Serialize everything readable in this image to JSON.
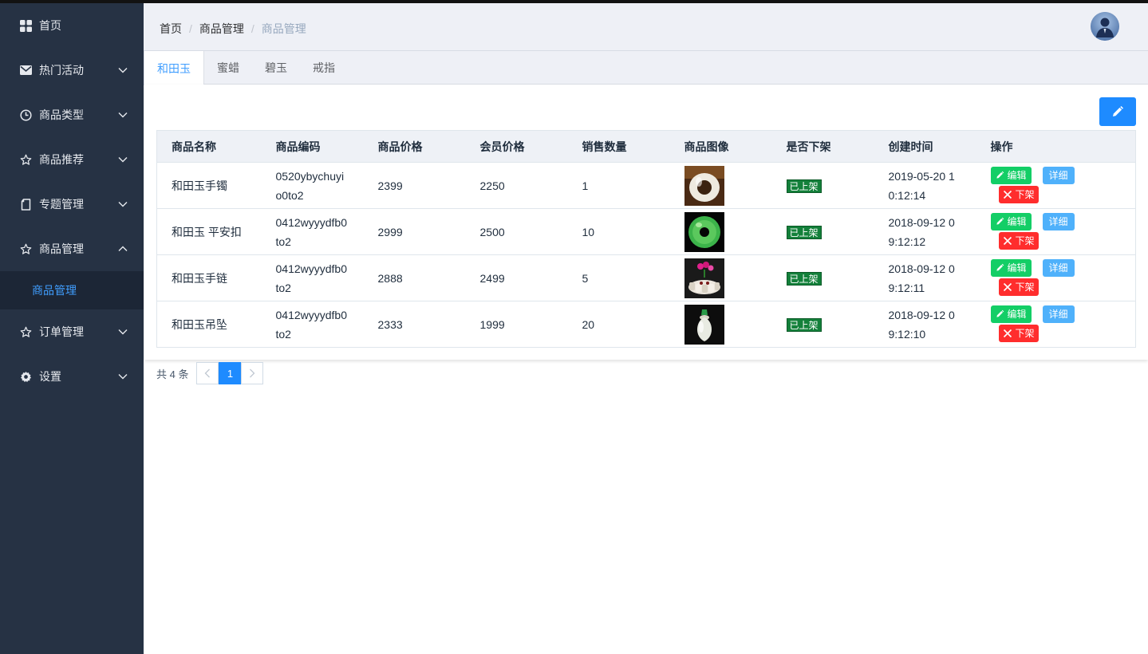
{
  "sidebar": {
    "items": [
      {
        "label": "首页",
        "icon": "dashboard-icon",
        "expanded": null
      },
      {
        "label": "热门活动",
        "icon": "envelope-icon",
        "expanded": false
      },
      {
        "label": "商品类型",
        "icon": "clock-icon",
        "expanded": false
      },
      {
        "label": "商品推荐",
        "icon": "star-icon",
        "expanded": false
      },
      {
        "label": "专题管理",
        "icon": "document-icon",
        "expanded": false
      },
      {
        "label": "商品管理",
        "icon": "star-icon",
        "expanded": true
      },
      {
        "label": "订单管理",
        "icon": "star-icon",
        "expanded": false
      },
      {
        "label": "设置",
        "icon": "gear-icon",
        "expanded": false
      }
    ],
    "submenu": {
      "label": "商品管理"
    }
  },
  "breadcrumb": [
    "首页",
    "商品管理",
    "商品管理"
  ],
  "tabs": [
    "和田玉",
    "蜜蜡",
    "碧玉",
    "戒指"
  ],
  "table": {
    "headers": [
      "商品名称",
      "商品编码",
      "商品价格",
      "会员价格",
      "销售数量",
      "商品图像",
      "是否下架",
      "创建时间",
      "操作"
    ],
    "rows": [
      {
        "name": "和田玉手镯",
        "code_l1": "0520ybychuyi",
        "code_l2": "o0to2",
        "price": "2399",
        "member_price": "2250",
        "sales": "1",
        "status": "已上架",
        "time_l1": "2019-05-20 1",
        "time_l2": "0:12:14"
      },
      {
        "name": "和田玉 平安扣",
        "code_l1": "0412wyyydfb0",
        "code_l2": "to2",
        "price": "2999",
        "member_price": "2500",
        "sales": "10",
        "status": "已上架",
        "time_l1": "2018-09-12 0",
        "time_l2": "9:12:12"
      },
      {
        "name": "和田玉手链",
        "code_l1": "0412wyyydfb0",
        "code_l2": "to2",
        "price": "2888",
        "member_price": "2499",
        "sales": "5",
        "status": "已上架",
        "time_l1": "2018-09-12 0",
        "time_l2": "9:12:11"
      },
      {
        "name": "和田玉吊坠",
        "code_l1": "0412wyyydfb0",
        "code_l2": "to2",
        "price": "2333",
        "member_price": "1999",
        "sales": "20",
        "status": "已上架",
        "time_l1": "2018-09-12 0",
        "time_l2": "9:12:10"
      }
    ],
    "ops": {
      "edit": "编辑",
      "detail": "详细",
      "offshelf": "下架"
    }
  },
  "pagination": {
    "total": "共 4 条",
    "page": "1"
  },
  "colors": {
    "sidebar_bg": "#263244",
    "accent": "#409eff",
    "primary_btn": "#1e8bff",
    "green": "#13ce66",
    "red": "#ff2d2d",
    "status_bg": "#13803a"
  }
}
